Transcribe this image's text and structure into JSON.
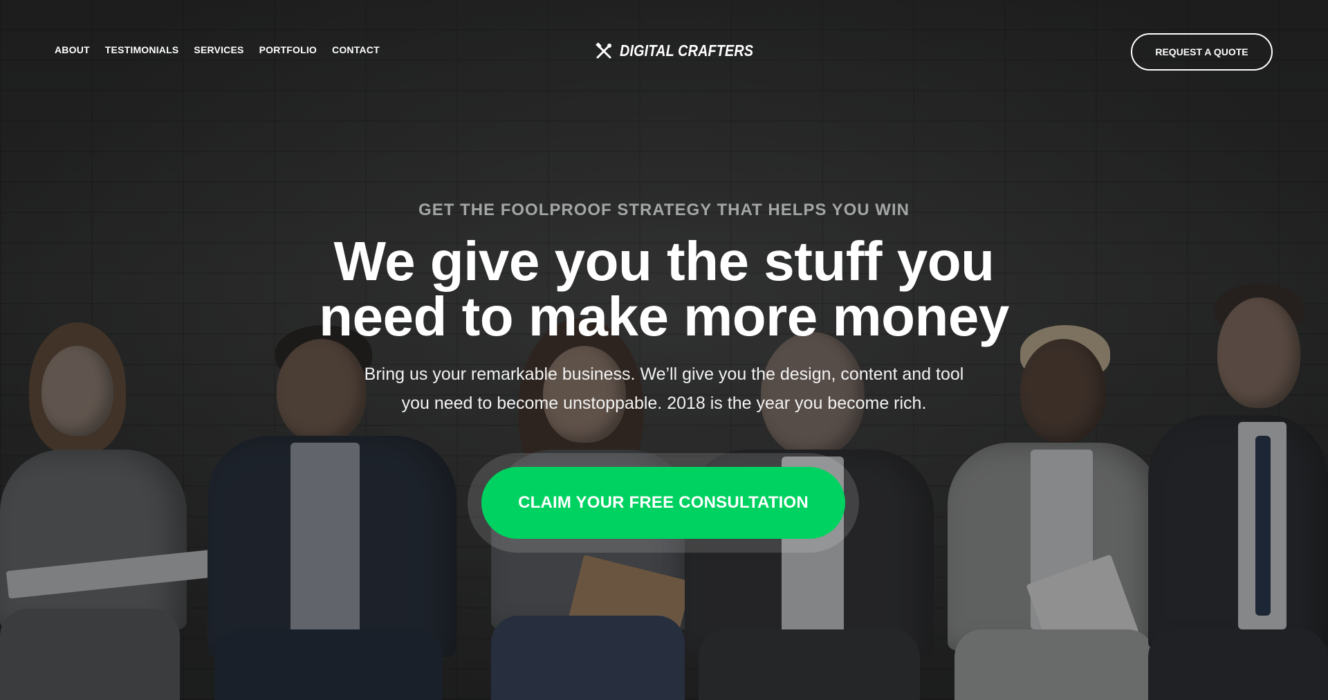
{
  "nav": {
    "items": [
      {
        "label": "ABOUT"
      },
      {
        "label": "TESTIMONIALS"
      },
      {
        "label": "SERVICES"
      },
      {
        "label": "PORTFOLIO"
      },
      {
        "label": "CONTACT"
      }
    ]
  },
  "logo": {
    "text": "DIGITAL CRAFTERS",
    "icon": "crossed-tools-icon"
  },
  "header": {
    "quote_button": "REQUEST A QUOTE"
  },
  "hero": {
    "eyebrow": "GET THE FOOLPROOF STRATEGY THAT HELPS YOU WIN",
    "headline_line1": "We give you the stuff you",
    "headline_line2": "need to make more money",
    "subtext_line1": "Bring us your remarkable business. We’ll give you the design, content and tool",
    "subtext_line2": "you need to become unstoppable. 2018 is the year you become rich.",
    "cta_label": "CLAIM YOUR FREE CONSULTATION"
  },
  "colors": {
    "accent": "#00d261",
    "text": "#ffffff",
    "eyebrow": "#a4a6a6"
  }
}
